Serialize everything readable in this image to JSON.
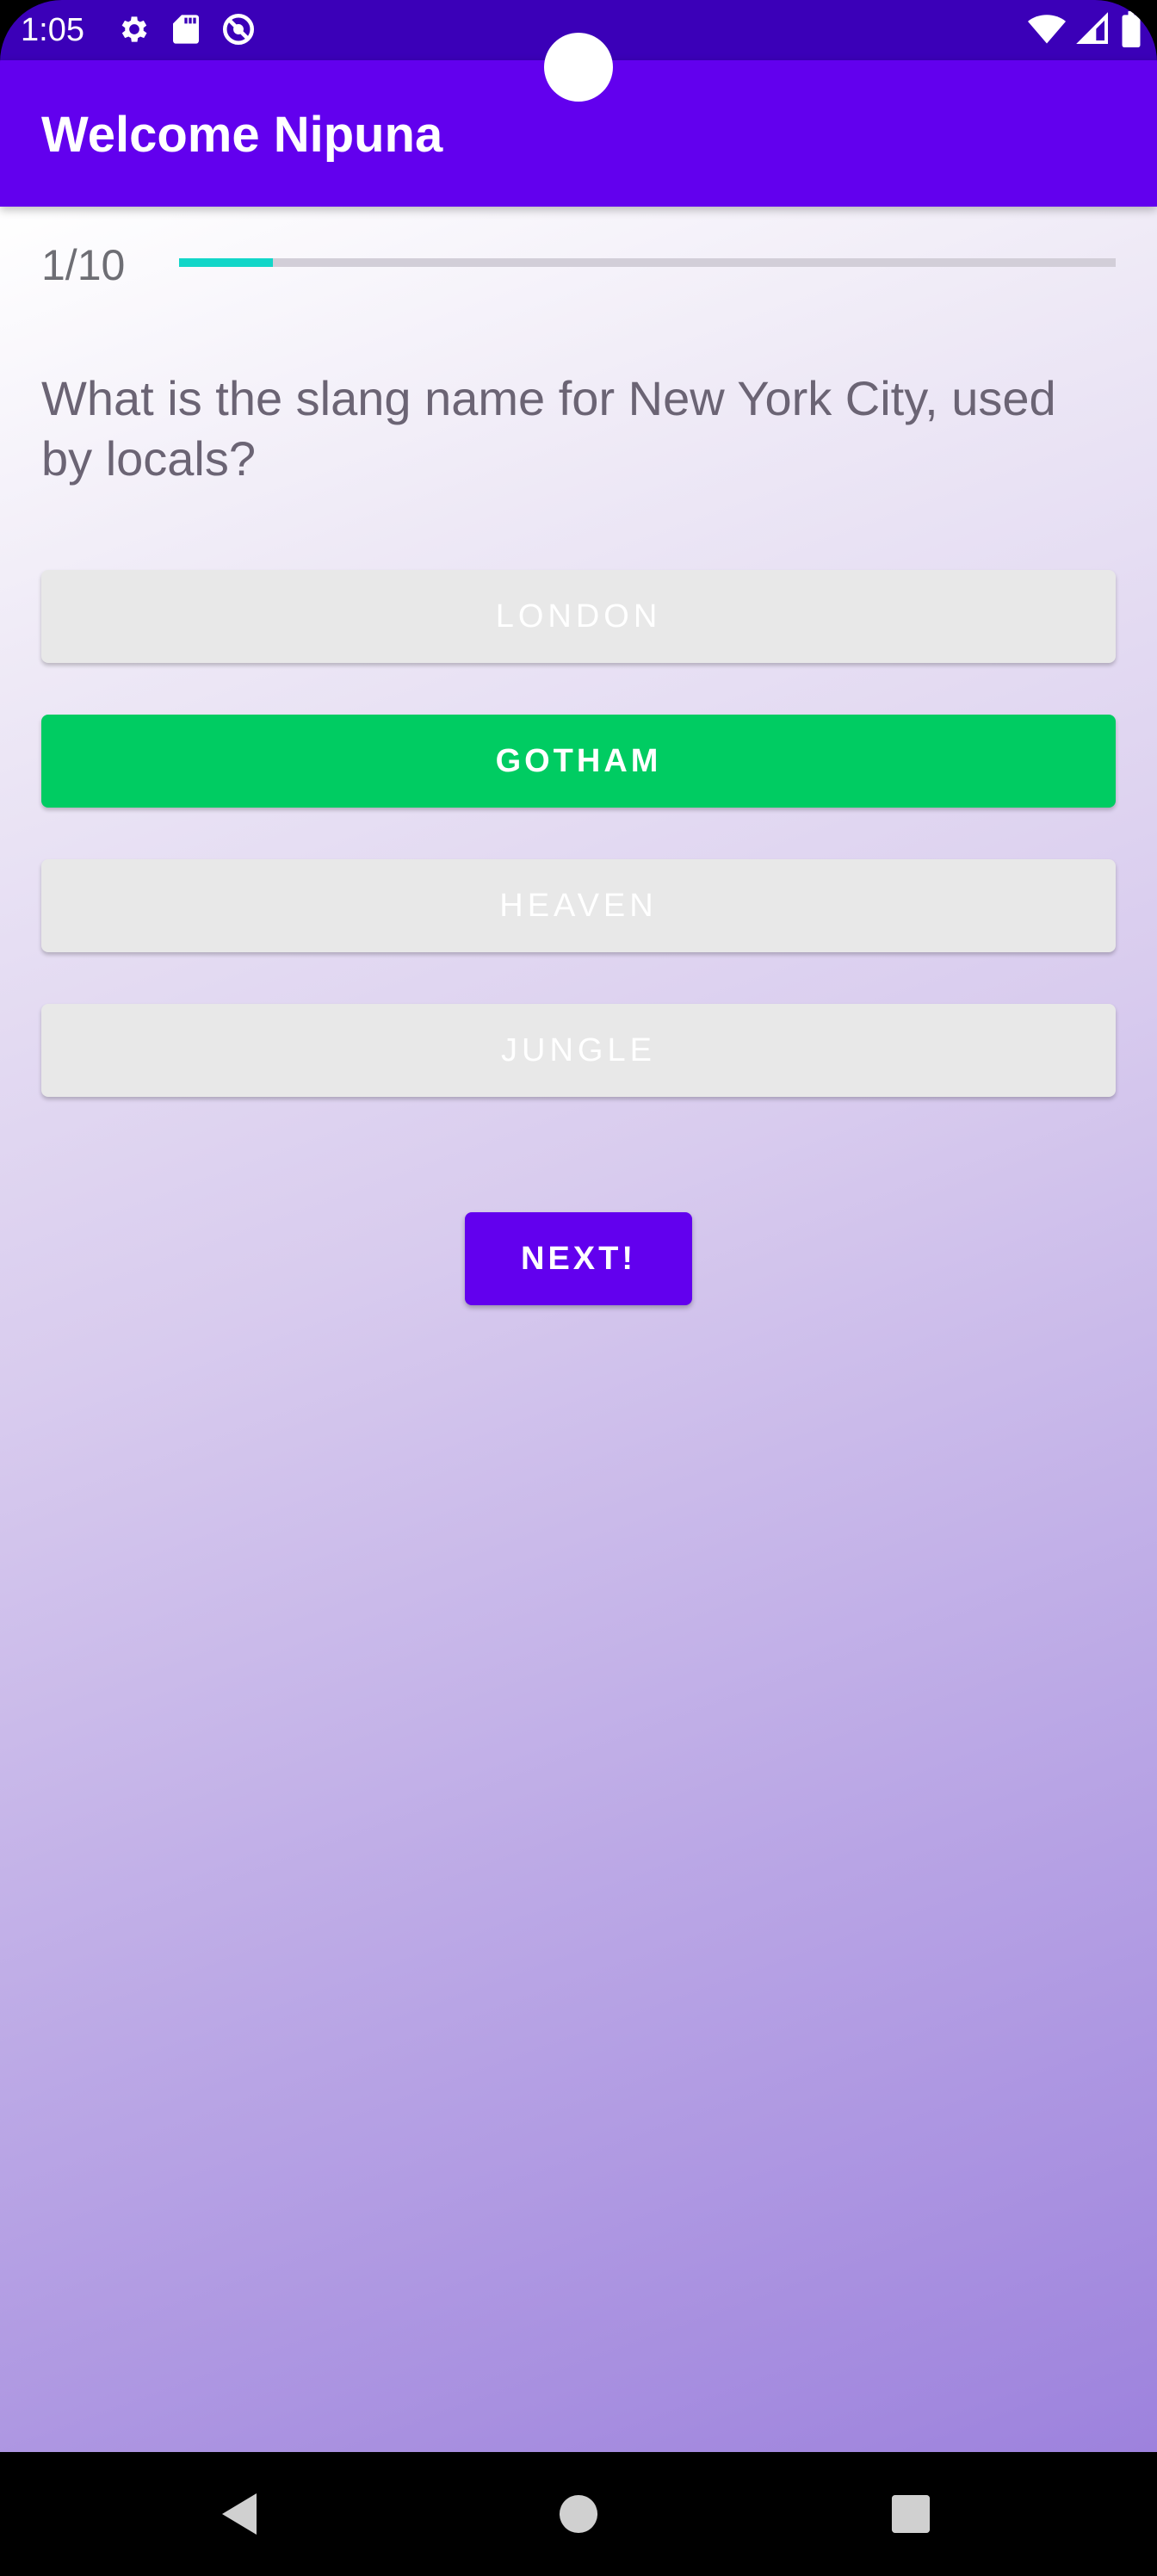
{
  "status_bar": {
    "time": "1:05",
    "left_icons": [
      "settings-icon",
      "sd-card-icon",
      "do-not-disturb-icon"
    ],
    "right_icons": [
      "wifi-icon",
      "signal-icon",
      "battery-icon"
    ]
  },
  "app_bar": {
    "title": "Welcome Nipuna"
  },
  "quiz": {
    "progress_label": "1/10",
    "progress": 0.1,
    "question": "What is the slang name for New York City, used by locals?",
    "options": [
      {
        "label": "LONDON",
        "selected": false
      },
      {
        "label": "GOTHAM",
        "selected": true
      },
      {
        "label": "HEAVEN",
        "selected": false
      },
      {
        "label": "JUNGLE",
        "selected": false
      }
    ],
    "next_label": "NEXT!"
  },
  "nav_bar": {
    "buttons": [
      "back-icon",
      "home-icon",
      "recents-icon"
    ]
  },
  "colors": {
    "primary": "#6200ee",
    "status_bar": "#3b00b8",
    "selected_option": "#00cc62",
    "unselected_option": "#e8e8e8",
    "progress_fill": "#12d6c8"
  }
}
